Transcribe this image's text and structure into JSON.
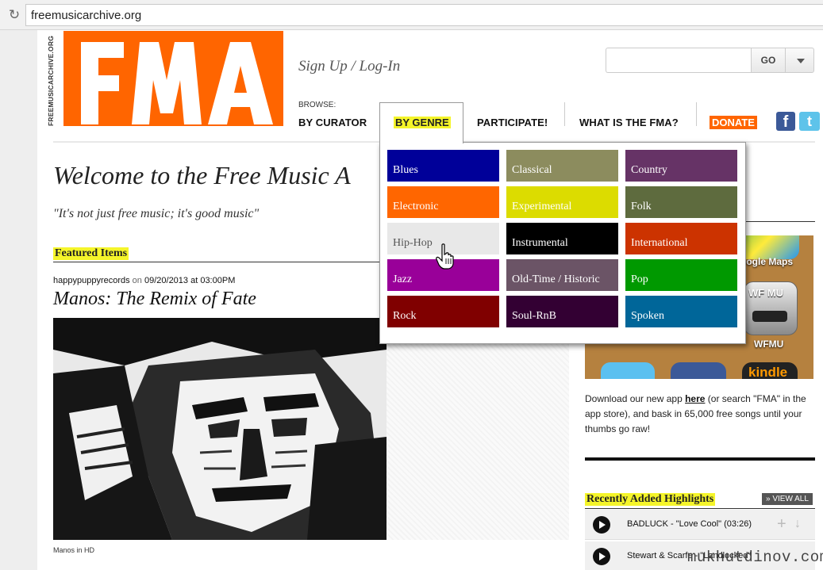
{
  "browser": {
    "url": "freemusicarchive.org",
    "reload_icon": "reload-icon"
  },
  "header": {
    "vertical_url": "FREEMUSICARCHIVE.ORG",
    "logo_text": "FMA",
    "signup": "Sign Up / Log-In",
    "browse_label": "BROWSE:",
    "nav": {
      "by_curator": "BY CURATOR",
      "by_genre": "BY GENRE",
      "participate": "PARTICIPATE!",
      "what_is": "WHAT IS THE FMA?",
      "donate": "DONATE"
    },
    "search": {
      "value": "",
      "go_label": "GO"
    },
    "social": {
      "facebook": "f",
      "twitter": "t"
    }
  },
  "main": {
    "welcome": "Welcome to the Free Music A",
    "tagline": "\"It's not just free music; it's good music\"",
    "featured_label": "Featured Items",
    "item": {
      "curator": "happypuppyrecords",
      "on_text": " on ",
      "date": "09/20/2013 at 03:00PM",
      "title": "Manos: The Remix of Fate",
      "caption": "Manos in HD"
    }
  },
  "genre_menu": {
    "items": [
      {
        "label": "Blues",
        "bg": "#000099",
        "fg": "#ffffff"
      },
      {
        "label": "Classical",
        "bg": "#8c8c5e",
        "fg": "#ffffff"
      },
      {
        "label": "Country",
        "bg": "#663366",
        "fg": "#ffffff"
      },
      {
        "label": "Electronic",
        "bg": "#ff6600",
        "fg": "#ffffff"
      },
      {
        "label": "Experimental",
        "bg": "#dcdc00",
        "fg": "#ffffff"
      },
      {
        "label": "Folk",
        "bg": "#5e6b3e",
        "fg": "#ffffff"
      },
      {
        "label": "Hip-Hop",
        "bg": "#e8e8e8",
        "fg": "#555555"
      },
      {
        "label": "Instrumental",
        "bg": "#000000",
        "fg": "#ffffff"
      },
      {
        "label": "International",
        "bg": "#cc3300",
        "fg": "#ffffff"
      },
      {
        "label": "Jazz",
        "bg": "#990099",
        "fg": "#ffffff"
      },
      {
        "label": "Old-Time / Historic",
        "bg": "#6b5466",
        "fg": "#ffffff"
      },
      {
        "label": "Pop",
        "bg": "#009900",
        "fg": "#ffffff"
      },
      {
        "label": "Rock",
        "bg": "#800000",
        "fg": "#ffffff"
      },
      {
        "label": "Soul-RnB",
        "bg": "#330033",
        "fg": "#ffffff"
      },
      {
        "label": "Spoken",
        "bg": "#006699",
        "fg": "#ffffff"
      }
    ]
  },
  "sidebar": {
    "apps": {
      "maps_label": "oogle Maps",
      "wfmu_badge": "WF MU",
      "wfmu_label": "WFMU",
      "kindle_label": "kindle"
    },
    "app_text_before": "Download our new app ",
    "app_link": "here",
    "app_text_after": " (or search \"FMA\" in the app store), and bask in 65,000 free songs until your thumbs go raw!",
    "recent_label": "Recently Added Highlights",
    "view_all": "» VIEW ALL",
    "tracks": [
      {
        "text": "BADLUCK - \"Love Cool\" (03:26)"
      },
      {
        "text": "Stewart & Scarfe - \"Landlocked\""
      }
    ]
  },
  "watermark": "mukhutdinov.com",
  "colors": {
    "accent_orange": "#ff6500",
    "highlight_yellow": "#f5f52a"
  }
}
